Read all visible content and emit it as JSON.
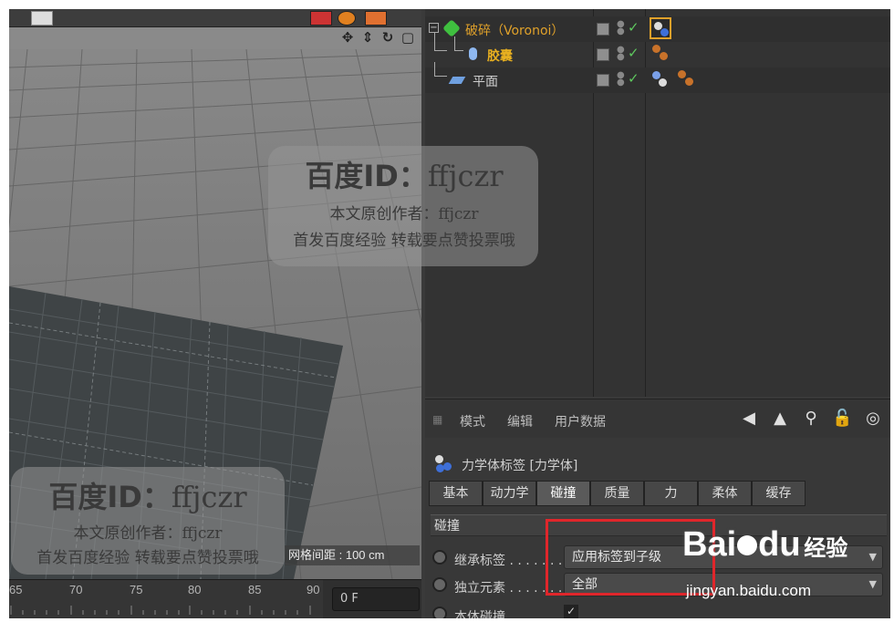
{
  "viewport": {
    "grid_spacing_label": "网格间距 : 100 cm",
    "timeline_ticks": [
      "65",
      "70",
      "75",
      "80",
      "85",
      "90"
    ],
    "current_frame": "0 F"
  },
  "object_manager": {
    "objects": [
      {
        "name": "破碎（Voronoi）",
        "color": "#e0a12a",
        "icon": "voronoi-fracture-icon"
      },
      {
        "name": "胶囊",
        "color": "#e8b020",
        "icon": "capsule-icon"
      },
      {
        "name": "平面",
        "color": "#d0d0d0",
        "icon": "plane-icon"
      }
    ]
  },
  "attribute_manager": {
    "menu": [
      "模式",
      "编辑",
      "用户数据"
    ],
    "tag_title": "力学体标签 [力学体]",
    "tabs": [
      "基本",
      "动力学",
      "碰撞",
      "质量",
      "力",
      "柔体",
      "缓存"
    ],
    "active_tab": "碰撞",
    "section": "碰撞",
    "properties": [
      {
        "label": "继承标签 . . . . . . .",
        "value": "应用标签到子级"
      },
      {
        "label": "独立元素 . . . . . . .",
        "value": "全部"
      }
    ],
    "partial_label": "本体碰撞"
  },
  "watermark": {
    "title_cn": "百度ID：",
    "title_en": "ffjczr",
    "line1": "本文原创作者：ffjczr",
    "line2": "首发百度经验  转载要点赞投票哦"
  },
  "baidu_logo": {
    "brand": "Bai",
    "brand_suffix": "du",
    "cn": "经验",
    "url": "jingyan.baidu.com"
  },
  "colors": {
    "highlight": "#e0262b",
    "active_object": "#e0a12a"
  }
}
